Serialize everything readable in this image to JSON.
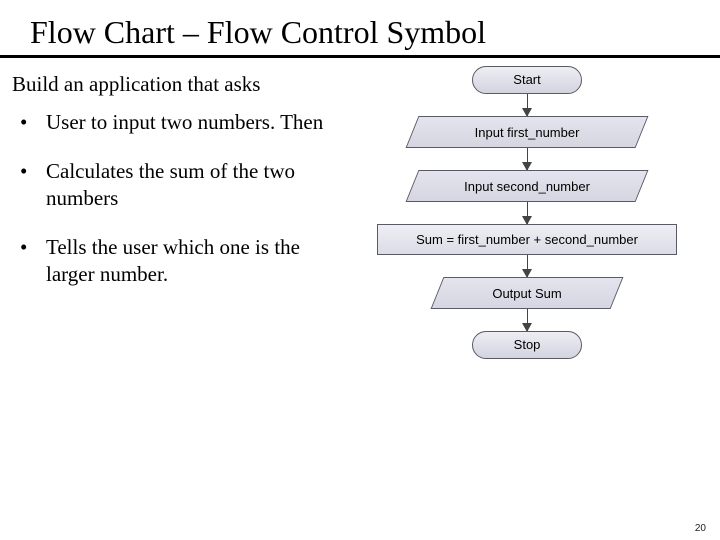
{
  "title": "Flow  Chart – Flow Control Symbol",
  "prompt": "Build an application that asks",
  "bullets": [
    "User to input two numbers. Then",
    "Calculates the sum of the two numbers",
    "Tells the user which one is the larger number."
  ],
  "flow": {
    "start": "Start",
    "input1": "Input first_number",
    "input2": "Input second_number",
    "process": "Sum = first_number + second_number",
    "output": "Output Sum",
    "stop": "Stop"
  },
  "page_number": "20"
}
